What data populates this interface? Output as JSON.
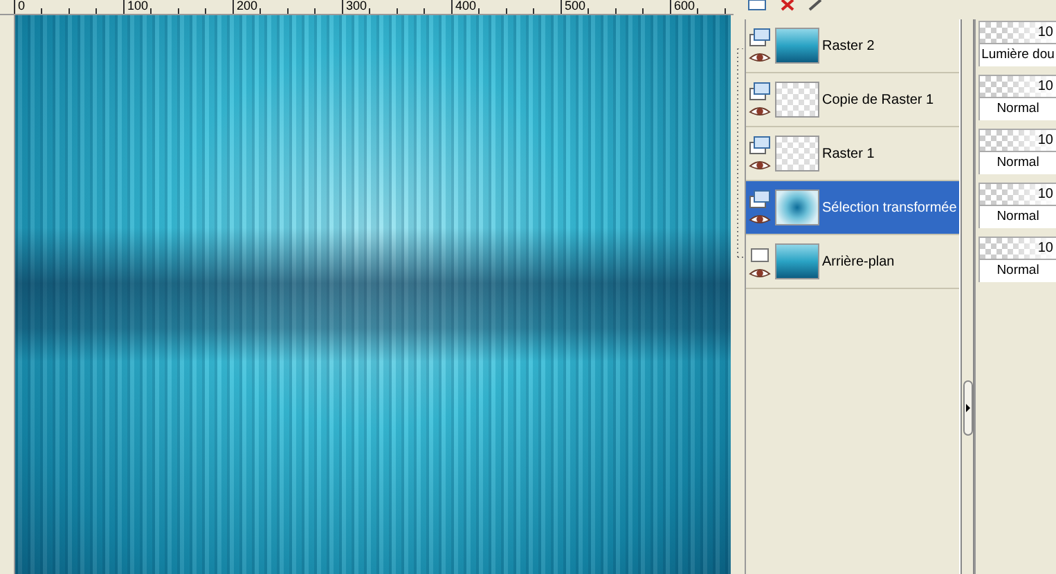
{
  "ruler": {
    "labels": [
      "0",
      "100",
      "200",
      "300",
      "400",
      "500",
      "600"
    ]
  },
  "layers": [
    {
      "name": "Raster 2",
      "kind": "raster",
      "transparent": false,
      "selected": false,
      "level": 1,
      "opacity": "10",
      "blend": "Lumière dou"
    },
    {
      "name": "Copie de Raster 1",
      "kind": "raster",
      "transparent": true,
      "selected": false,
      "level": 1,
      "opacity": "10",
      "blend": "Normal"
    },
    {
      "name": "Raster 1",
      "kind": "raster",
      "transparent": true,
      "selected": false,
      "level": 1,
      "opacity": "10",
      "blend": "Normal"
    },
    {
      "name": "Sélection transformée",
      "kind": "raster",
      "transparent": true,
      "selected": true,
      "level": 1,
      "opacity": "10",
      "blend": "Normal"
    },
    {
      "name": "Arrière-plan",
      "kind": "background",
      "transparent": false,
      "selected": false,
      "level": 1,
      "opacity": "10",
      "blend": "Normal"
    }
  ]
}
